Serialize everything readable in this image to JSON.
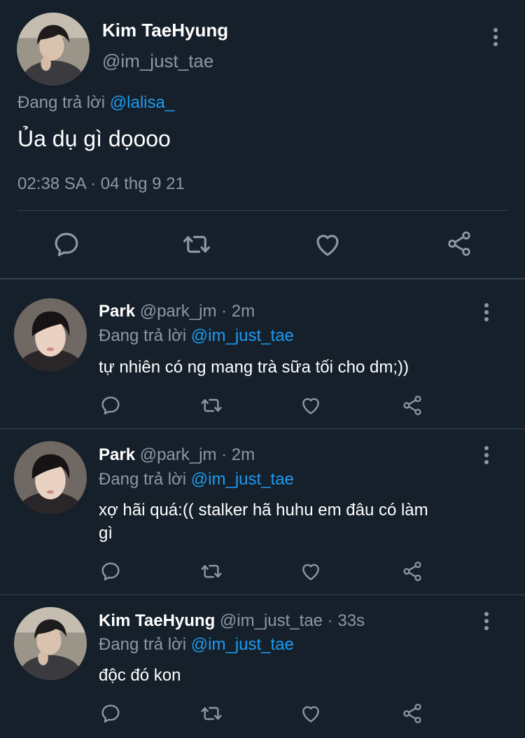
{
  "main_tweet": {
    "name": "Kim TaeHyung",
    "handle": "@im_just_tae",
    "replying_prefix": "Đang trả lời",
    "replying_to": "@lalisa_",
    "text": "Ủa dụ gì dọooo",
    "timestamp": "02:38 SA · 04 thg 9 21"
  },
  "replies": [
    {
      "name": "Park",
      "meta": "@park_jm · 2m",
      "replying_prefix": "Đang trả lời",
      "replying_to": "@im_just_tae",
      "text": "tự nhiên có ng mang trà sữa tối cho dm;))"
    },
    {
      "name": "Park",
      "meta": "@park_jm · 2m",
      "replying_prefix": "Đang trả lời",
      "replying_to": "@im_just_tae",
      "text_line1": "xợ hãi quá:(( stalker hã huhu em đâu có làm",
      "text_line2": "gì"
    },
    {
      "name": "Kim TaeHyung",
      "meta": "@im_just_tae · 33s",
      "replying_prefix": "Đang trả lời",
      "replying_to": "@im_just_tae",
      "text": "độc đó kon"
    }
  ],
  "colors": {
    "background": "#15202b",
    "muted": "#8b98a5",
    "link": "#1d9bf0",
    "divider": "#38444d"
  },
  "icons": [
    "more-icon",
    "reply-icon",
    "retweet-icon",
    "like-icon",
    "share-icon"
  ]
}
